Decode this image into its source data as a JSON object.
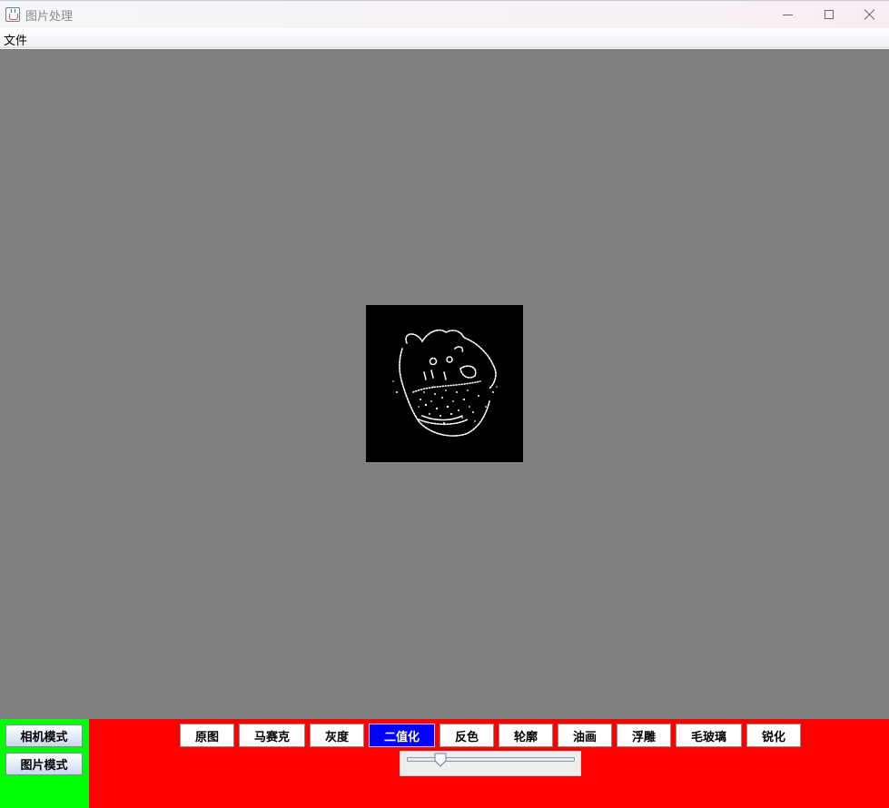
{
  "window": {
    "title": "图片处理",
    "icon": "java-cup-icon"
  },
  "menu": {
    "items": [
      "文件"
    ]
  },
  "preview": {
    "effect_shown": "二值化",
    "background": "#808080"
  },
  "modes": {
    "camera_label": "相机模式",
    "picture_label": "图片模式",
    "panel_color": "#00ff00"
  },
  "filters": {
    "panel_color": "#ff0000",
    "active_index": 3,
    "active_color": "#0000ff",
    "items": [
      {
        "label": "原图"
      },
      {
        "label": "马赛克"
      },
      {
        "label": "灰度"
      },
      {
        "label": "二值化"
      },
      {
        "label": "反色"
      },
      {
        "label": "轮廓"
      },
      {
        "label": "油画"
      },
      {
        "label": "浮雕"
      },
      {
        "label": "毛玻璃"
      },
      {
        "label": "锐化"
      }
    ]
  },
  "slider": {
    "value_fraction": 0.2
  }
}
